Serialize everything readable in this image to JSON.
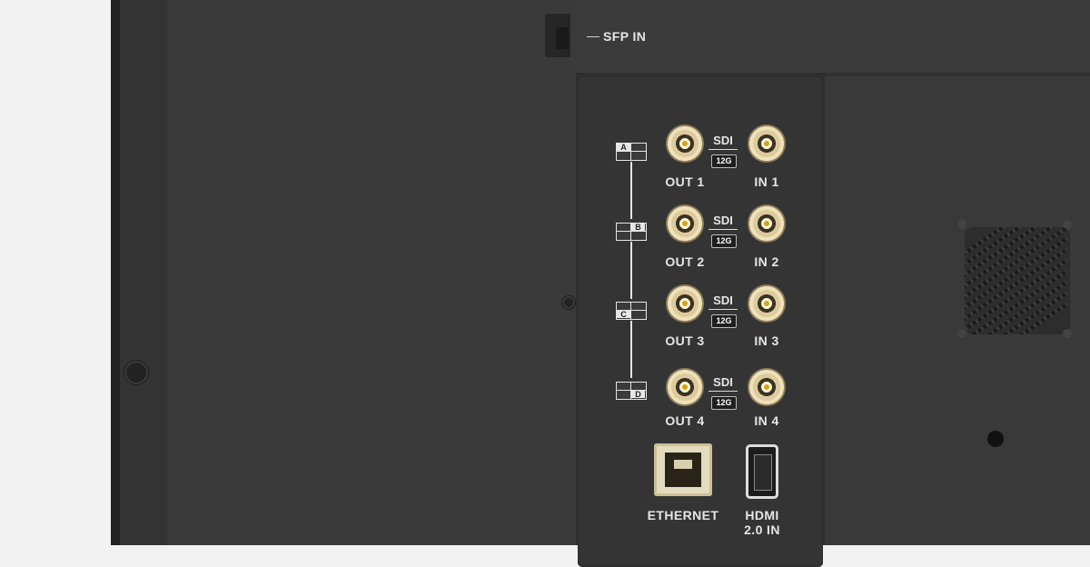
{
  "labels": {
    "sfp_in": "SFP IN",
    "ethernet": "ETHERNET",
    "hdmi_line1": "HDMI",
    "hdmi_line2": "2.0 IN"
  },
  "sdi_rows": [
    {
      "quad_letter": "A",
      "sdi": "SDI",
      "grade": "12G",
      "out_label": "OUT 1",
      "in_label": "IN 1"
    },
    {
      "quad_letter": "B",
      "sdi": "SDI",
      "grade": "12G",
      "out_label": "OUT 2",
      "in_label": "IN 2"
    },
    {
      "quad_letter": "C",
      "sdi": "SDI",
      "grade": "12G",
      "out_label": "OUT 3",
      "in_label": "IN 3"
    },
    {
      "quad_letter": "D",
      "sdi": "SDI",
      "grade": "12G",
      "out_label": "OUT 4",
      "in_label": "IN 4"
    }
  ],
  "colors": {
    "chassis": "#2f2f2f",
    "panel": "#3a3a3a",
    "label": "#e6e6e6",
    "bnc_gold": "#d7a21c",
    "ethernet_shell": "#e3dbbe"
  },
  "icons": [
    "screw-icon",
    "quad-split-icon",
    "bnc-connector-icon",
    "rj45-port-icon",
    "hdmi-port-icon",
    "speaker-grille-icon"
  ]
}
